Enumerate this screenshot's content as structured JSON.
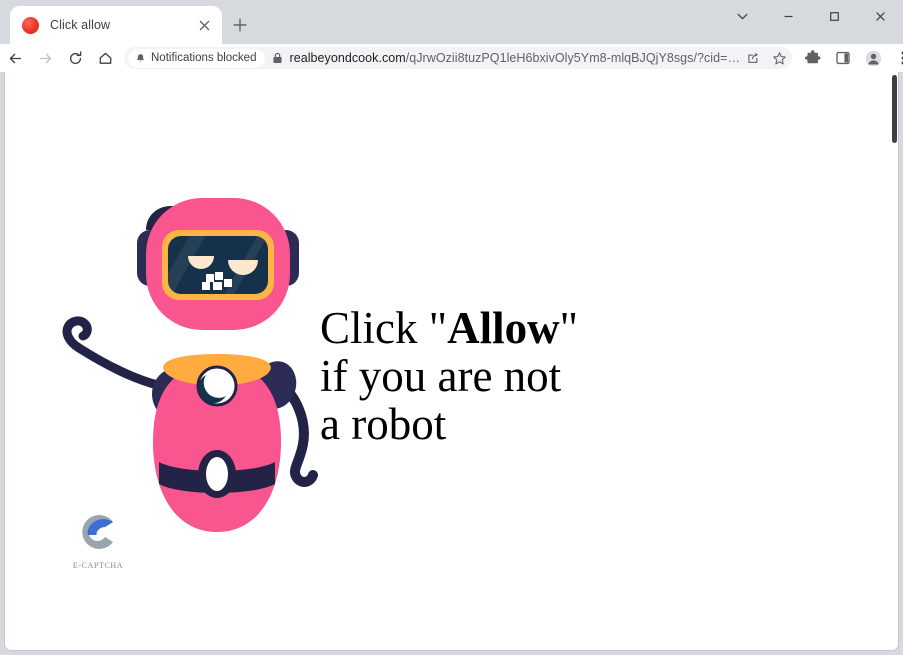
{
  "browser": {
    "tab": {
      "title": "Click allow",
      "favicon": "red-circle-favicon",
      "close_icon": "close-icon"
    },
    "new_tab_icon": "plus-icon",
    "window_controls": [
      {
        "name": "tab-search",
        "icon": "chevron-down-icon"
      },
      {
        "name": "minimize",
        "icon": "minimize-icon"
      },
      {
        "name": "maximize",
        "icon": "maximize-icon"
      },
      {
        "name": "close",
        "icon": "close-icon"
      }
    ],
    "nav": [
      {
        "name": "back",
        "icon": "arrow-left-icon",
        "enabled": true
      },
      {
        "name": "forward",
        "icon": "arrow-right-icon",
        "enabled": false
      },
      {
        "name": "reload",
        "icon": "reload-icon",
        "enabled": true
      },
      {
        "name": "home",
        "icon": "home-icon",
        "enabled": true
      }
    ],
    "omnibox": {
      "notification_chip": {
        "label": "Notifications blocked",
        "icon": "bell-icon"
      },
      "security_icon": "lock-icon",
      "url_host": "realbeyondcook.com",
      "url_path": "/qJrwOzii8tuzPQ1leH6bxivOly5Ym8-mlqBJQjY8sgs/?cid=…",
      "url_full": "realbeyondcook.com/qJrwOzii8tuzPQ1leH6bxivOly5Ym8-mlqBJQjY8sgs/?cid=…",
      "share_icon": "share-icon",
      "bookmark_icon": "star-icon"
    },
    "toolbar_icons": [
      {
        "name": "extensions",
        "icon": "puzzle-icon"
      },
      {
        "name": "side-panel",
        "icon": "side-panel-icon"
      },
      {
        "name": "profile",
        "icon": "avatar-icon"
      },
      {
        "name": "menu",
        "icon": "three-dots-icon"
      }
    ]
  },
  "page": {
    "headline": {
      "line1_prefix": "Click ",
      "line1_quote_open": "\"",
      "line1_bold": "Allow",
      "line1_quote_close": "\"",
      "line2": "if you are not",
      "line3": "a robot"
    },
    "captcha": {
      "logo_icon": "c-logo-icon",
      "label": "E-CAPTCHA"
    },
    "robot": {
      "name": "robot-mascot-illustration",
      "question_mark": "?",
      "colors": {
        "body_pink": "#f9558f",
        "dark_navy": "#232347",
        "visor_navy": "#16324a",
        "collar_orange": "#ffab3f",
        "visor_outline": "#ffb545",
        "eye_cream": "#fde8cf",
        "white": "#ffffff"
      }
    },
    "background_color": "#ffffff"
  }
}
